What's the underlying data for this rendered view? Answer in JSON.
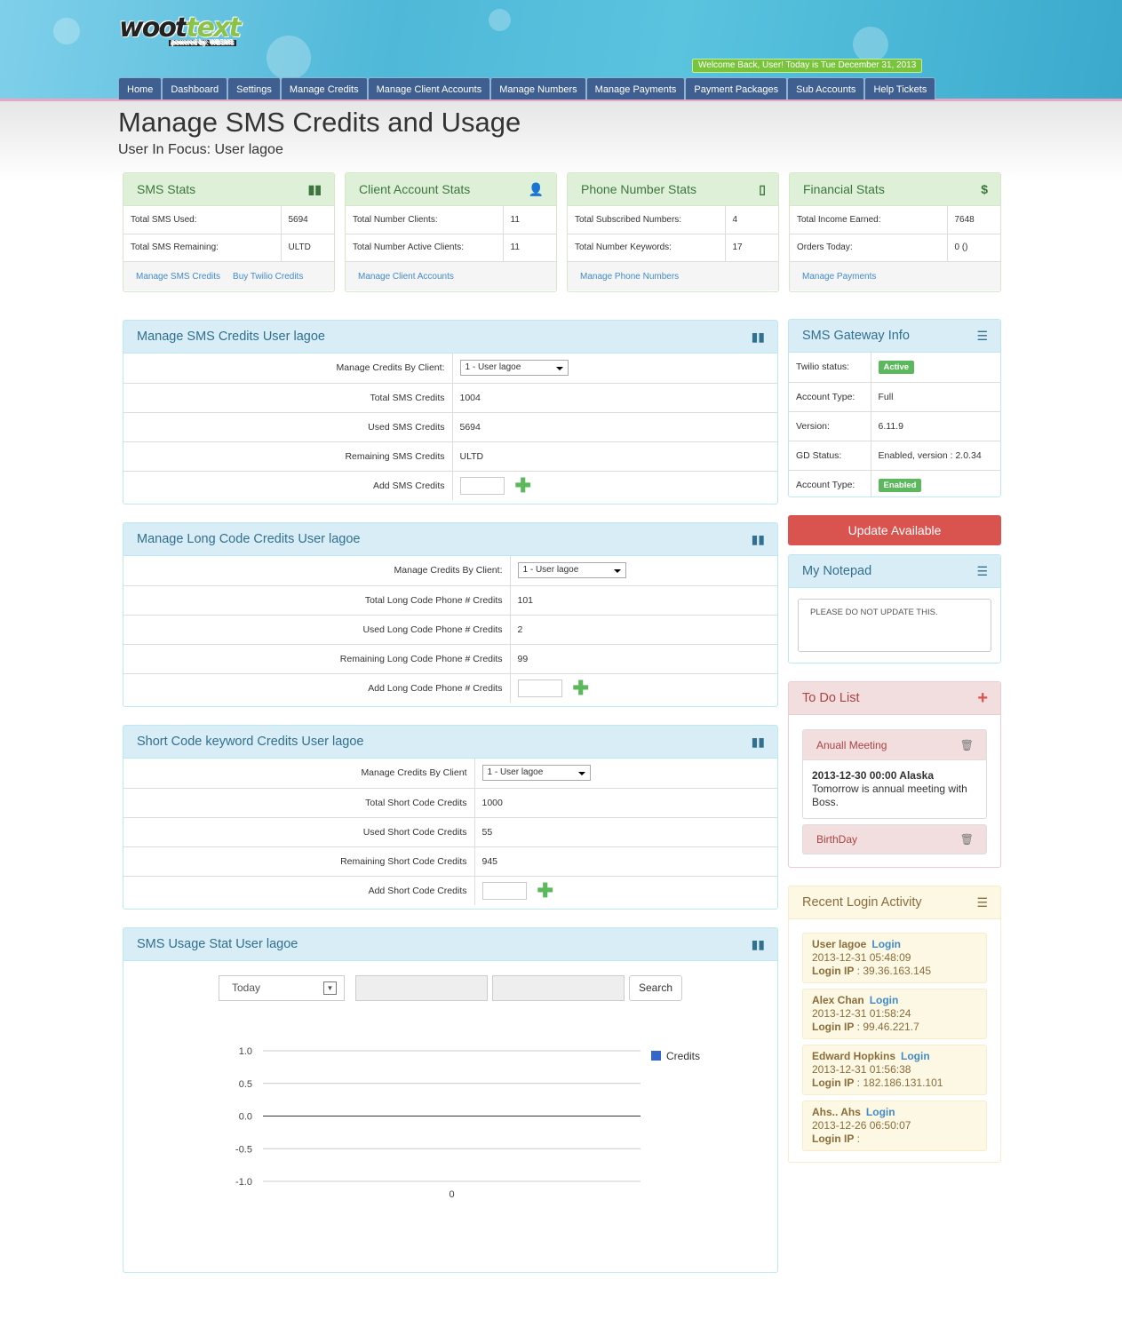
{
  "header": {
    "logo_main": "woot",
    "logo_accent": "text",
    "logo_sub": "powered by: WBSMS",
    "welcome": "Welcome Back, User! Today is Tue December 31, 2013"
  },
  "nav": [
    "Home",
    "Dashboard",
    "Settings",
    "Manage Credits",
    "Manage Client Accounts",
    "Manage Numbers",
    "Manage Payments",
    "Payment Packages",
    "Sub Accounts",
    "Help Tickets"
  ],
  "page": {
    "title": "Manage SMS Credits and Usage",
    "subtitle": "User In Focus: User lagoe"
  },
  "stats": [
    {
      "title": "SMS Stats",
      "icon": "bar-chart-icon",
      "rows": [
        [
          "Total SMS Used:",
          "5694"
        ],
        [
          "Total SMS Remaining:",
          "ULTD"
        ]
      ],
      "links": [
        "Manage SMS Credits",
        "Buy Twilio Credits"
      ]
    },
    {
      "title": "Client Account Stats",
      "icon": "user-icon",
      "rows": [
        [
          "Total Number Clients:",
          "11"
        ],
        [
          "Total Number Active Clients:",
          "11"
        ]
      ],
      "links": [
        "Manage Client Accounts"
      ]
    },
    {
      "title": "Phone Number Stats",
      "icon": "phone-icon",
      "rows": [
        [
          "Total Subscribed Numbers:",
          "4"
        ],
        [
          "Total Number Keywords:",
          "17"
        ]
      ],
      "links": [
        "Manage Phone Numbers"
      ]
    },
    {
      "title": "Financial Stats",
      "icon": "dollar-icon",
      "rows": [
        [
          "Total Income Earned:",
          "7648"
        ],
        [
          "Orders Today:",
          "0 ()"
        ]
      ],
      "links": [
        "Manage Payments"
      ]
    }
  ],
  "forms": [
    {
      "title": "Manage SMS Credits User lagoe",
      "rows": [
        [
          "Manage Credits By Client:",
          "1 - User lagoe"
        ],
        [
          "Total SMS Credits",
          "1004"
        ],
        [
          "Used SMS Credits",
          "5694"
        ],
        [
          "Remaining SMS Credits",
          "ULTD"
        ],
        [
          "Add SMS Credits",
          ""
        ]
      ]
    },
    {
      "title": "Manage Long Code Credits User lagoe",
      "rows": [
        [
          "Manage Credits By Client:",
          "1 - User lagoe"
        ],
        [
          "Total Long Code Phone # Credits",
          "101"
        ],
        [
          "Used Long Code Phone # Credits",
          "2"
        ],
        [
          "Remaining Long Code Phone # Credits",
          "99"
        ],
        [
          "Add Long Code Phone # Credits",
          ""
        ]
      ]
    },
    {
      "title": "Short Code keyword Credits User lagoe",
      "rows": [
        [
          "Manage Credits By Client",
          "1 - User lagoe"
        ],
        [
          "Total Short Code Credits",
          "1000"
        ],
        [
          "Used Short Code Credits",
          "55"
        ],
        [
          "Remaining Short Code Credits",
          "945"
        ],
        [
          "Add Short Code Credits",
          ""
        ]
      ]
    }
  ],
  "usage": {
    "title": "SMS Usage Stat User lagoe",
    "range": "Today",
    "search": "Search"
  },
  "chart_data": {
    "type": "line",
    "x": [
      0
    ],
    "series": [
      {
        "name": "Credits",
        "values": [
          0
        ]
      }
    ],
    "color": "#3366cc",
    "yticks": [
      "1.0",
      "0.5",
      "0.0",
      "-0.5",
      "-1.0"
    ],
    "xticks": [
      "0"
    ],
    "ylim": [
      -1,
      1
    ],
    "legend": "right"
  },
  "gateway": {
    "title": "SMS Gateway Info",
    "rows": [
      [
        "Twilio status:",
        "Active",
        "badge"
      ],
      [
        "Account Type:",
        "Full",
        ""
      ],
      [
        "Version:",
        "6.11.9",
        ""
      ],
      [
        "GD Status:",
        "Enabled, version : 2.0.34",
        ""
      ],
      [
        "Account Type:",
        "Enabled",
        "badge"
      ]
    ]
  },
  "update": "Update Available",
  "notepad": {
    "title": "My Notepad",
    "text": "PLEASE DO NOT UPDATE THIS."
  },
  "todo": {
    "title": "To Do List",
    "items": [
      {
        "title": "Anuall Meeting",
        "date": "2013-12-30 00:00 Alaska",
        "body": "Tomorrow is annual meeting with Boss."
      },
      {
        "title": "BirthDay"
      }
    ]
  },
  "logins": {
    "title": "Recent Login Activity",
    "link": "Login",
    "ip_label": "Login IP",
    "items": [
      {
        "name": "User lagoe",
        "time": "2013-12-31 05:48:09",
        "ip": "39.36.163.145"
      },
      {
        "name": "Alex Chan",
        "time": "2013-12-31 01:58:24",
        "ip": "99.46.221.7"
      },
      {
        "name": "Edward Hopkins",
        "time": "2013-12-31 01:56:38",
        "ip": "182.186.131.101"
      },
      {
        "name": "Ahs.. Ahs",
        "time": "2013-12-26 06:50:07",
        "ip": ""
      }
    ]
  }
}
